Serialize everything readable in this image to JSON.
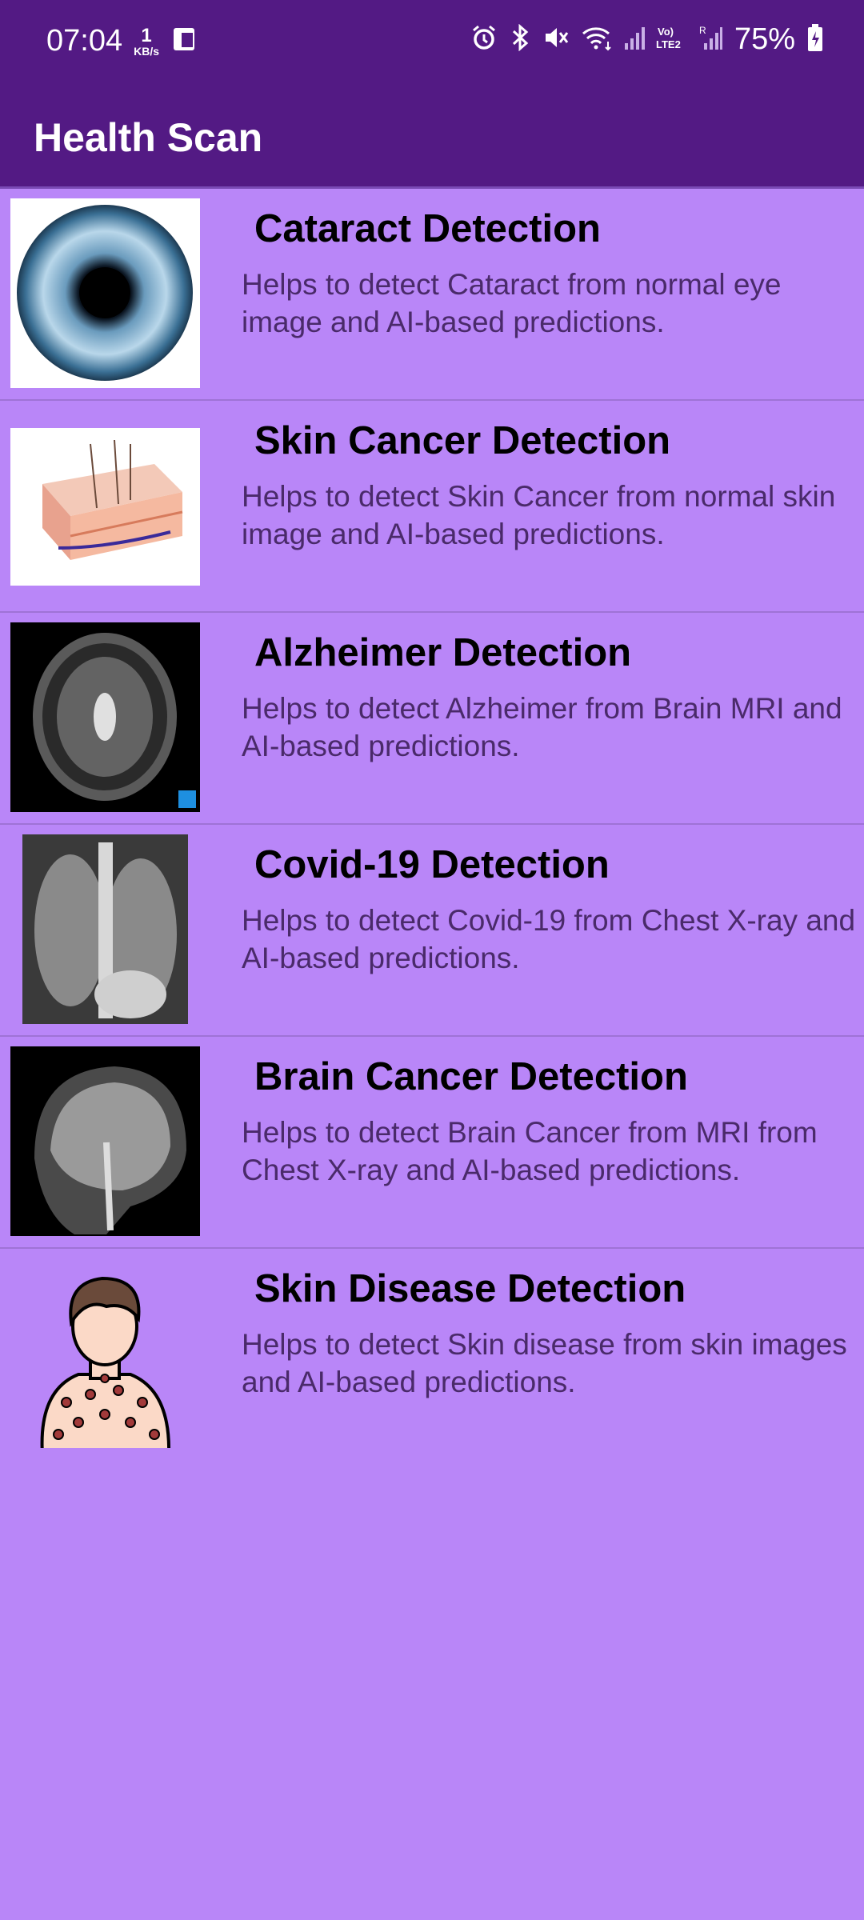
{
  "status": {
    "time": "07:04",
    "net_speed_value": "1",
    "net_speed_unit": "KB/s",
    "battery": "75%"
  },
  "app": {
    "title": "Health Scan"
  },
  "items": [
    {
      "title": "Cataract Detection",
      "description": "Helps to detect Cataract from normal eye image and AI-based predictions."
    },
    {
      "title": "Skin Cancer Detection",
      "description": "Helps to detect Skin Cancer from normal skin image and AI-based predictions."
    },
    {
      "title": "Alzheimer Detection",
      "description": "Helps to detect Alzheimer from Brain MRI and AI-based predictions."
    },
    {
      "title": "Covid-19 Detection",
      "description": "Helps to detect Covid-19 from Chest X-ray and AI-based predictions."
    },
    {
      "title": "Brain Cancer Detection",
      "description": "Helps to detect Brain Cancer from MRI from Chest X-ray and AI-based predictions."
    },
    {
      "title": "Skin Disease Detection",
      "description": "Helps to detect Skin disease from skin images and AI-based predictions."
    }
  ],
  "colors": {
    "appbar": "#531a84",
    "background": "#b986f8"
  }
}
